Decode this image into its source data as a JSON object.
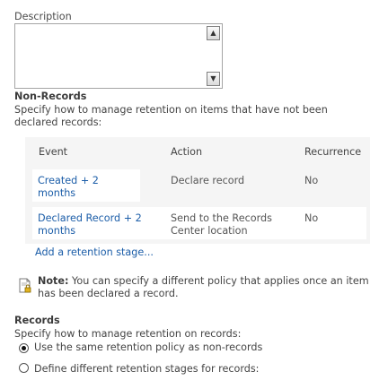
{
  "description": {
    "label": "Description",
    "value": ""
  },
  "non_records": {
    "title": "Non-Records",
    "description": "Specify how to manage retention on items that have not been declared records:",
    "table": {
      "headers": [
        "Event",
        "Action",
        "Recurrence"
      ],
      "rows": [
        {
          "event": "Created + 2 months",
          "action": "Declare record",
          "recurrence": "No"
        },
        {
          "event": "Declared Record + 2 months",
          "action": "Send to the Records Center location",
          "recurrence": "No"
        }
      ]
    },
    "add_stage_link": "Add a retention stage..."
  },
  "note": {
    "label": "Note:",
    "text": " You can specify a different policy that applies once an item has been declared a record."
  },
  "records": {
    "title": "Records",
    "description": "Specify how to manage retention on records:",
    "options": [
      {
        "label": "Use the same retention policy as non-records",
        "selected": true
      },
      {
        "label": "Define different retention stages for records:",
        "selected": false
      }
    ]
  },
  "icons": {
    "scroll_up": "scroll-up-arrow",
    "scroll_down": "scroll-down-arrow",
    "note": "document-lock-note-icon"
  }
}
